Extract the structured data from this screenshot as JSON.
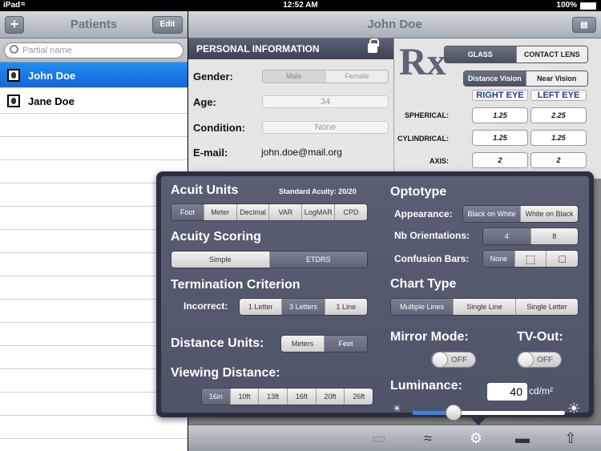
{
  "status": {
    "carrier": "iPad",
    "time": "12:52 AM",
    "battery": "100%"
  },
  "left": {
    "title": "Patients",
    "add_label": "+",
    "edit_label": "Edit",
    "search_placeholder": "Partial name",
    "patients": [
      {
        "name": "John Doe",
        "selected": true
      },
      {
        "name": "Jane Doe",
        "selected": false
      }
    ]
  },
  "right": {
    "title": "John Doe",
    "personal": {
      "header": "PERSONAL INFORMATION",
      "gender_label": "Gender:",
      "gender_options": [
        "Male",
        "Female"
      ],
      "age_label": "Age:",
      "age_value": "34",
      "condition_label": "Condition:",
      "condition_value": "None",
      "email_label": "E-mail:",
      "email_value": "john.doe@mail.org"
    },
    "rx": {
      "logo": "Rx",
      "type_options": [
        "GLASS",
        "CONTACT LENS"
      ],
      "type_selected": "GLASS",
      "vision_options": [
        "Distance Vision",
        "Near Vision"
      ],
      "vision_selected": "Distance Vision",
      "right_eye": "RIGHT EYE",
      "left_eye": "LEFT EYE",
      "rows": [
        {
          "label": "SPHERICAL:",
          "right": "1.25",
          "left": "2.25"
        },
        {
          "label": "CYLINDRICAL:",
          "right": "1.25",
          "left": "1.25"
        },
        {
          "label": "AXIS:",
          "right": "2",
          "left": "2"
        }
      ]
    }
  },
  "settings": {
    "acuity_units_title": "Acuit Units",
    "standard_acuity": "Standard Acuity: 20/20",
    "acuity_units": [
      "Foot",
      "Meter",
      "Decimal",
      "VAR",
      "LogMAR",
      "CPD"
    ],
    "acuity_units_selected": "Foot",
    "acuity_scoring_title": "Acuity Scoring",
    "acuity_scoring": [
      "Simple",
      "ETDRS"
    ],
    "acuity_scoring_selected": "ETDRS",
    "termination_title": "Termination Criterion",
    "incorrect_label": "Incorrect:",
    "incorrect_options": [
      "1 Letter",
      "3 Letters",
      "1 Line"
    ],
    "incorrect_selected": "3 Letters",
    "distance_units_label": "Distance Units:",
    "distance_units": [
      "Meters",
      "Feet"
    ],
    "distance_units_selected": "Feet",
    "viewing_distance_title": "Viewing Distance:",
    "viewing_distances": [
      "16in",
      "10ft",
      "13ft",
      "16ft",
      "20ft",
      "26ft"
    ],
    "viewing_distance_selected": "16in",
    "optotype_title": "Optotype",
    "appearance_label": "Appearance:",
    "appearance_options": [
      "Black on White",
      "White on Black"
    ],
    "appearance_selected": "Black on White",
    "nb_orientations_label": "Nb Orientations:",
    "nb_orientations": [
      "4",
      "8"
    ],
    "nb_orientations_selected": "4",
    "confusion_bars_label": "Confusion Bars:",
    "confusion_bars_options": [
      "None",
      "",
      ""
    ],
    "confusion_bars_selected": "None",
    "chart_type_title": "Chart Type",
    "chart_types": [
      "Multiple Lines",
      "Single Line",
      "Single Letter"
    ],
    "chart_type_selected": "Multiple Lines",
    "mirror_mode_label": "Mirror Mode:",
    "mirror_mode_value": "OFF",
    "tv_out_label": "TV-Out:",
    "tv_out_value": "OFF",
    "luminance_label": "Luminance:",
    "luminance_value": "40",
    "luminance_unit": "cd/m²",
    "luminance_level": 0.27
  },
  "toolbar": {
    "icons": [
      "monitor-icon",
      "wifi-icon",
      "gear-icon",
      "slider-icon",
      "share-icon"
    ]
  }
}
